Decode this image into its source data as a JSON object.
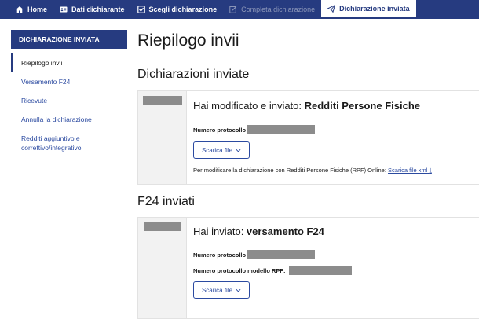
{
  "nav": {
    "items": [
      {
        "label": "Home",
        "icon": "home-icon",
        "state": "normal"
      },
      {
        "label": "Dati dichiarante",
        "icon": "id-card-icon",
        "state": "normal"
      },
      {
        "label": "Scegli dichiarazione",
        "icon": "checkbox-icon",
        "state": "normal"
      },
      {
        "label": "Completa dichiarazione",
        "icon": "edit-icon",
        "state": "disabled"
      },
      {
        "label": "Dichiarazione inviata",
        "icon": "send-icon",
        "state": "active"
      }
    ]
  },
  "sidebar": {
    "heading": "DICHIARAZIONE INVIATA",
    "items": [
      {
        "label": "Riepilogo invii",
        "active": true
      },
      {
        "label": "Versamento F24",
        "active": false
      },
      {
        "label": "Ricevute",
        "active": false
      },
      {
        "label": "Annulla la dichiarazione",
        "active": false
      },
      {
        "label": "Redditi aggiuntivo e correttivo/integrativo",
        "active": false
      }
    ]
  },
  "main": {
    "title": "Riepilogo invii",
    "sections": [
      {
        "title": "Dichiarazioni inviate",
        "card": {
          "heading_prefix": "Hai modificato e inviato: ",
          "heading_bold": "Redditi Persone Fisiche",
          "protocol_label": "Numero protocollo",
          "button_label": "Scarica file",
          "note_text": "Per modificare la dichiarazione con Redditi Persone Fisiche (RPF) Online: ",
          "note_link": "Scarica file xml"
        }
      },
      {
        "title": "F24 inviati",
        "card": {
          "heading_prefix": "Hai inviato: ",
          "heading_bold": "versamento F24",
          "protocol_label": "Numero protocollo",
          "protocol_rpf_label": "Numero protocollo modello RPF:",
          "button_label": "Scarica file"
        }
      }
    ]
  },
  "colors": {
    "nav_bg": "#263b80",
    "link": "#2b4aa0",
    "redaction": "#8c8c8c"
  }
}
